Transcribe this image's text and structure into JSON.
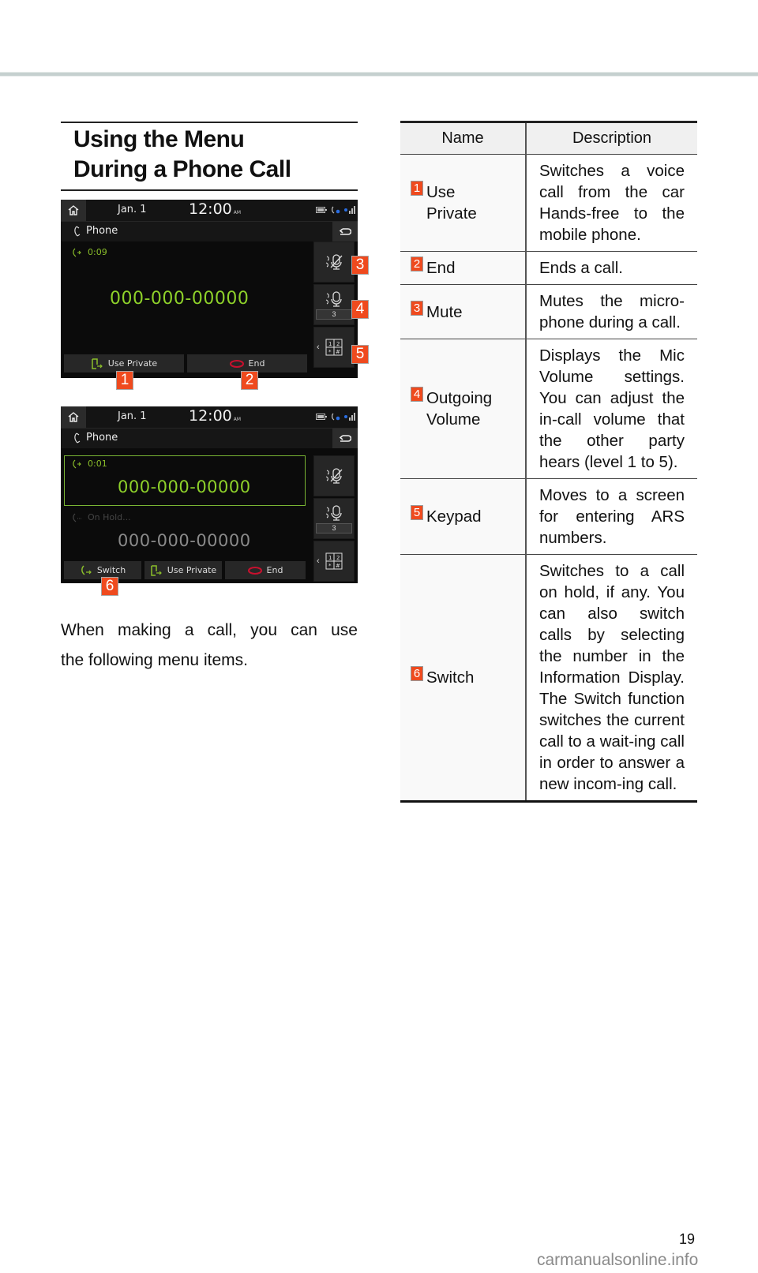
{
  "heading": {
    "line1": "Using the Menu",
    "line2": "During a Phone Call"
  },
  "screens": [
    {
      "status": {
        "date": "Jan.  1",
        "time": "12:00",
        "ampm": "AM"
      },
      "title": "Phone",
      "call": {
        "timer": "0:09",
        "number": "000-000-00000"
      },
      "volume_level": "3",
      "buttons": [
        "Use Private",
        "End"
      ],
      "callouts": [
        "1",
        "2",
        "3",
        "4",
        "5"
      ]
    },
    {
      "status": {
        "date": "Jan.  1",
        "time": "12:00",
        "ampm": "AM"
      },
      "title": "Phone",
      "active_call": {
        "timer": "0:01",
        "number": "000-000-00000"
      },
      "held_call": {
        "status": "On Hold...",
        "number": "000-000-00000"
      },
      "volume_level": "3",
      "buttons": [
        "Switch",
        "Use Private",
        "End"
      ],
      "callouts": [
        "6"
      ]
    }
  ],
  "intro": {
    "line1": "When making a call, you can use",
    "line2": "the following menu items."
  },
  "table": {
    "headers": [
      "Name",
      "Description"
    ],
    "rows": [
      {
        "num": "1",
        "name": "Use Private",
        "name_lines": [
          "Use",
          "Private"
        ],
        "description": "Switches a voice call from the car Hands-free to the mobile phone."
      },
      {
        "num": "2",
        "name": "End",
        "name_lines": [
          "End"
        ],
        "description": "Ends a call."
      },
      {
        "num": "3",
        "name": "Mute",
        "name_lines": [
          "Mute"
        ],
        "description": "Mutes the micro-phone during a call."
      },
      {
        "num": "4",
        "name": "Outgoing Volume",
        "name_lines": [
          "Outgoing",
          "Volume"
        ],
        "description": "Displays the Mic Volume settings. You can adjust the in-call volume that the other party hears (level 1 to 5)."
      },
      {
        "num": "5",
        "name": "Keypad",
        "name_lines": [
          "Keypad"
        ],
        "description": "Moves to a screen for entering ARS numbers."
      },
      {
        "num": "6",
        "name": "Switch",
        "name_lines": [
          "Switch"
        ],
        "description": "Switches to a call on hold, if any. You can also switch calls by selecting the number in the Information Display. The Switch function switches the current call to a wait-ing call in order to answer a new incom-ing call."
      }
    ]
  },
  "footer": {
    "page_number": "19",
    "watermark": "carmanualsonline.info"
  },
  "colors": {
    "callout": "#ef4a1e",
    "call_green": "#8bbf2a",
    "end_red": "#c8102e",
    "rule": "#c5d0cf"
  }
}
